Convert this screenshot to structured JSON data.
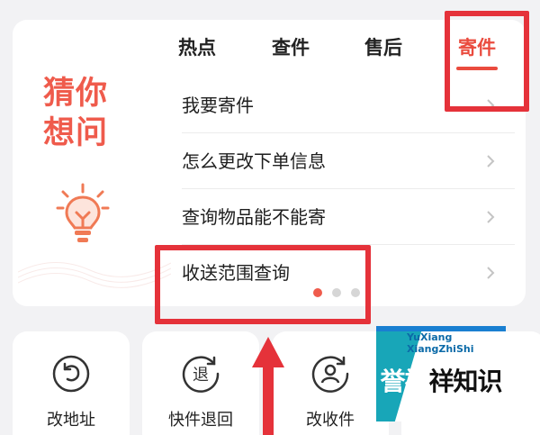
{
  "guess_title": "猜你想问",
  "tabs": [
    {
      "label": "热点",
      "active": false
    },
    {
      "label": "查件",
      "active": false
    },
    {
      "label": "售后",
      "active": false
    },
    {
      "label": "寄件",
      "active": true
    }
  ],
  "qa_items": [
    {
      "label": "我要寄件"
    },
    {
      "label": "怎么更改下单信息"
    },
    {
      "label": "查询物品能不能寄"
    },
    {
      "label": "收送范围查询"
    }
  ],
  "pagination": {
    "total": 3,
    "active_index": 0
  },
  "shortcuts": [
    {
      "label": "改地址",
      "icon": "undo-circle-icon"
    },
    {
      "label": "快件退回",
      "icon": "return-badge-icon"
    },
    {
      "label": "改收件",
      "icon": "user-circle-icon"
    }
  ],
  "watermark": {
    "en_line1": "YuXiang",
    "en_line2": "XiangZhiShi",
    "cn_part1": "誉",
    "cn_part2": "祥",
    "cn_part3": "祥知识"
  },
  "colors": {
    "accent": "#ea4b3e",
    "annotation": "#e5323a",
    "title": "#ef5b4c"
  }
}
